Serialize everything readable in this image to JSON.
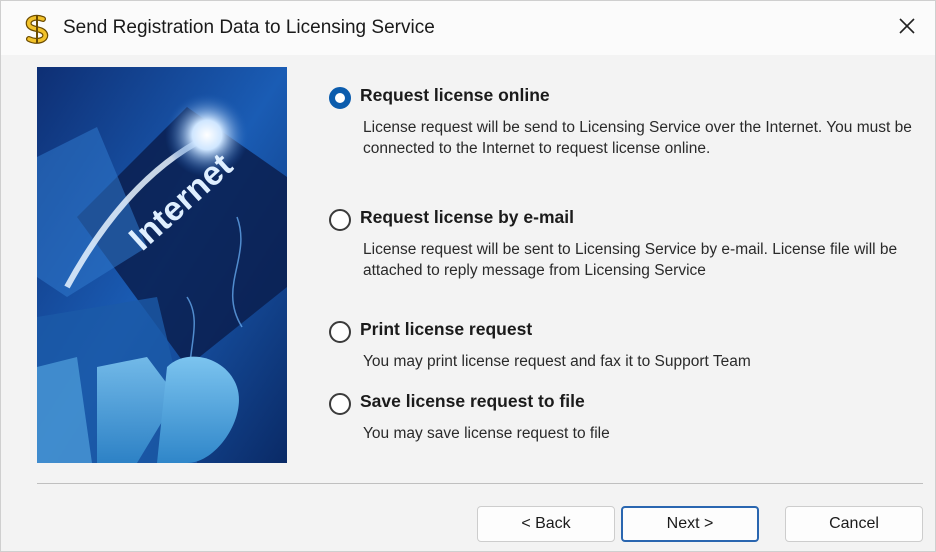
{
  "window": {
    "title": "Send Registration Data to Licensing Service",
    "app_icon": "dollar-s-icon",
    "close_icon": "close-icon"
  },
  "side_image": {
    "text": "Internet",
    "description_icon": "internet-banner-art"
  },
  "options": [
    {
      "label": "Request license online",
      "description": "License request will be send to Licensing Service over the Internet. You must be connected to the Internet to request license online.",
      "checked": true
    },
    {
      "label": "Request license by e-mail",
      "description": "License request will be sent to Licensing Service by e-mail. License file will be attached to reply message from Licensing Service",
      "checked": false
    },
    {
      "label": "Print license request",
      "description": "You may print license request and fax it to Support Team",
      "checked": false
    },
    {
      "label": "Save license request to file",
      "description": "You may save license request to file",
      "checked": false
    }
  ],
  "buttons": {
    "back": "< Back",
    "next": "Next >",
    "cancel": "Cancel"
  },
  "colors": {
    "radio_selected": "#0b5cad",
    "default_button_border": "#2a66b0",
    "dialog_background": "#f3f3f3"
  }
}
